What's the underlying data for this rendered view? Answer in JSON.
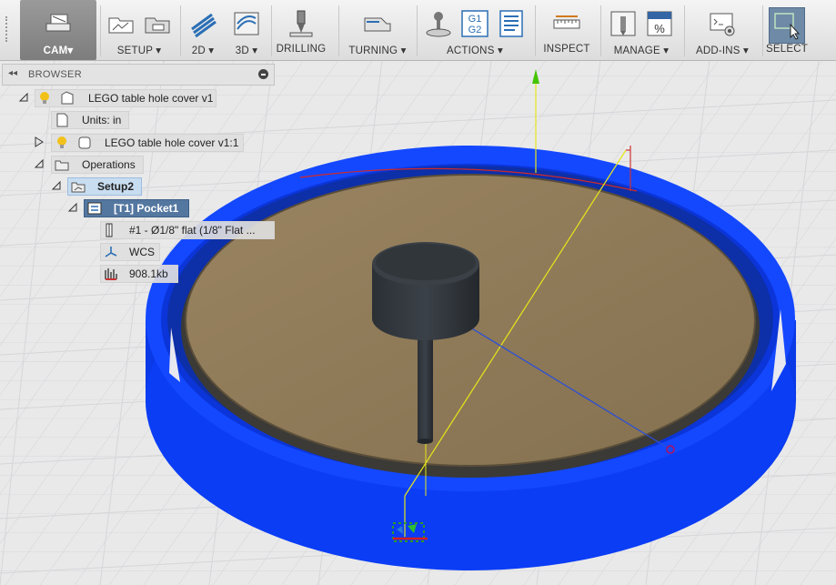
{
  "toolbar": {
    "workspace": {
      "label": "CAM▾",
      "icon": "cam-workspace-icon"
    },
    "groups": [
      {
        "label": "SETUP ▾",
        "icons": [
          "new-setup-icon",
          "setup-folder-icon"
        ]
      },
      {
        "label": "2D ▾",
        "icons": [
          "2d-pocket-icon"
        ]
      },
      {
        "label": "3D ▾",
        "icons": [
          "3d-adaptive-icon"
        ]
      },
      {
        "label": "DRILLING",
        "icons": [
          "drill-icon"
        ]
      },
      {
        "label": "TURNING ▾",
        "icons": [
          "turning-icon"
        ]
      },
      {
        "label": "ACTIONS ▾",
        "icons": [
          "simulate-icon",
          "post-process-g1g2-icon",
          "setup-sheet-icon"
        ]
      },
      {
        "label": "INSPECT",
        "icons": [
          "measure-icon"
        ]
      },
      {
        "label": "MANAGE ▾",
        "icons": [
          "tool-library-icon",
          "post-library-icon"
        ]
      },
      {
        "label": "ADD-INS ▾",
        "icons": [
          "scripts-addins-icon"
        ]
      },
      {
        "label": "SELECT",
        "icons": [
          "select-cursor-icon"
        ]
      }
    ],
    "g1g2": [
      "G1",
      "G2"
    ],
    "percent": "%"
  },
  "browser": {
    "title": "BROWSER",
    "tree": [
      {
        "label": "LEGO table hole cover v1",
        "icon": "document-icon",
        "expanded": true
      },
      {
        "label": "Units: in",
        "icon": "units-doc-icon"
      },
      {
        "label": "LEGO table hole cover v1:1",
        "icon": "component-icon",
        "expanded": false
      },
      {
        "label": "Operations",
        "icon": "folder-icon",
        "expanded": true
      },
      {
        "label": "Setup2",
        "icon": "setup-folder-icon",
        "expanded": true
      },
      {
        "label": "[T1] Pocket1",
        "icon": "pocket-op-icon",
        "expanded": true
      },
      {
        "label": "#1 - Ø1/8\" flat (1/8\" Flat ...",
        "icon": "tool-icon"
      },
      {
        "label": "WCS",
        "icon": "wcs-axes-icon"
      },
      {
        "label": "908.1kb",
        "icon": "toolpath-size-icon"
      }
    ]
  },
  "colors": {
    "stock": "#0b3df5",
    "part_top": "#8f7b5b",
    "tool_head": "#2a2e33",
    "selection": "#5477a0",
    "axis_y": "#43c400"
  }
}
